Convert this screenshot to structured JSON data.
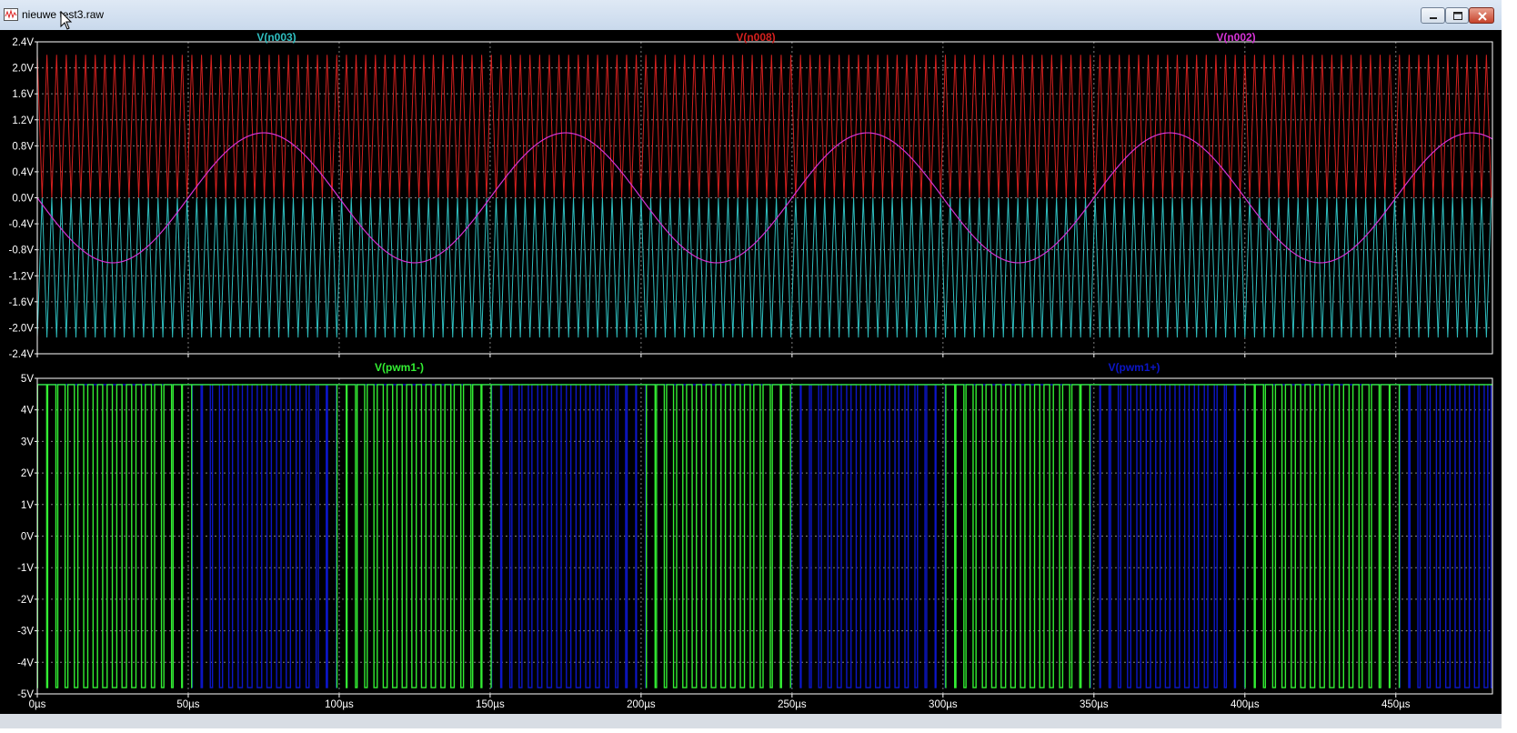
{
  "window": {
    "title": "nieuwe test3.raw",
    "icon": "waveform-file-icon",
    "controls": [
      "minimize-icon",
      "maximize-icon",
      "close-icon"
    ]
  },
  "colors": {
    "background": "#000000",
    "axis": "#ffffff",
    "grid": "#7f7f7f",
    "n003": "#2fbfc0",
    "n008": "#d4201e",
    "n002": "#d633d6",
    "pwm_minus": "#33ee33",
    "pwm_plus": "#0c16c8"
  },
  "chart_data": [
    {
      "type": "line",
      "title": "",
      "x_unit": "µs",
      "y_unit": "V",
      "xlim": [
        0,
        482
      ],
      "ylim": [
        -2.4,
        2.4
      ],
      "x_ticks": [
        "0µs",
        "50µs",
        "100µs",
        "150µs",
        "200µs",
        "250µs",
        "300µs",
        "350µs",
        "400µs",
        "450µs"
      ],
      "y_ticks": [
        "2.4V",
        "2.0V",
        "1.6V",
        "1.2V",
        "0.8V",
        "0.4V",
        "0.0V",
        "-0.4V",
        "-0.8V",
        "-1.2V",
        "-1.6V",
        "-2.0V",
        "-2.4V"
      ],
      "grid": true,
      "series": [
        {
          "name": "V(n003)",
          "kind": "triangle carrier",
          "min": -2.15,
          "max": 0.0,
          "period_us": 3.2
        },
        {
          "name": "V(n008)",
          "kind": "triangle carrier",
          "min": 0.0,
          "max": 2.2,
          "period_us": 3.2
        },
        {
          "name": "V(n002)",
          "kind": "sine",
          "amplitude": 1.0,
          "period_us": 100,
          "phase_start": "falling from 0"
        }
      ],
      "labels": {
        "n003": "V(n003)",
        "n008": "V(n008)",
        "n002": "V(n002)"
      }
    },
    {
      "type": "line",
      "title": "",
      "x_unit": "µs",
      "y_unit": "V",
      "xlim": [
        0,
        482
      ],
      "ylim": [
        -5,
        5
      ],
      "x_ticks": [
        "0µs",
        "50µs",
        "100µs",
        "150µs",
        "200µs",
        "250µs",
        "300µs",
        "350µs",
        "400µs",
        "450µs"
      ],
      "y_ticks": [
        "5V",
        "4V",
        "3V",
        "2V",
        "1V",
        "0V",
        "-1V",
        "-2V",
        "-3V",
        "-4V",
        "-5V"
      ],
      "grid": true,
      "series": [
        {
          "name": "V(pwm1-)",
          "kind": "pwm",
          "high": 4.8,
          "low": -4.8,
          "active_during": "V(n002) < 0"
        },
        {
          "name": "V(pwm1+)",
          "kind": "pwm",
          "high": 4.8,
          "low": -4.8,
          "active_during": "V(n002) > 0"
        }
      ],
      "labels": {
        "pwm_minus": "V(pwm1-)",
        "pwm_plus": "V(pwm1+)"
      }
    }
  ]
}
